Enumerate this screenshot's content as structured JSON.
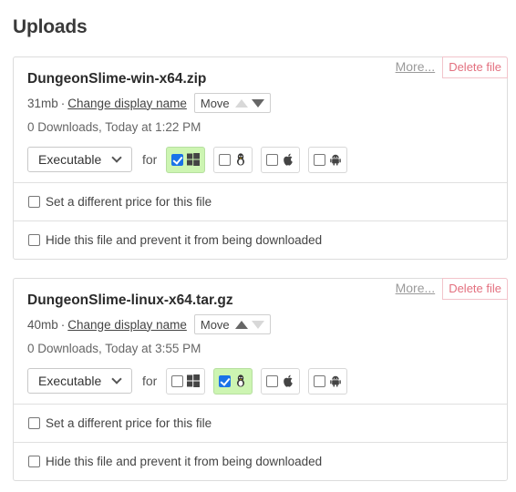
{
  "page": {
    "title": "Uploads"
  },
  "common": {
    "more_label": "More...",
    "delete_label": "Delete file",
    "change_name_label": "Change display name",
    "move_label": "Move",
    "separator": "·",
    "for_label": "for",
    "price_option": "Set a different price for this file",
    "hide_option": "Hide this file and prevent it from being downloaded"
  },
  "uploads": [
    {
      "file_name": "DungeonSlime-win-x64.zip",
      "size": "31mb",
      "stats": "0 Downloads, Today at 1:22 PM",
      "type": "Executable",
      "move_up_enabled": false,
      "move_down_enabled": true,
      "platforms": {
        "windows": true,
        "linux": false,
        "mac": false,
        "android": false
      },
      "price_checked": false,
      "hide_checked": false
    },
    {
      "file_name": "DungeonSlime-linux-x64.tar.gz",
      "size": "40mb",
      "stats": "0 Downloads, Today at 3:55 PM",
      "type": "Executable",
      "move_up_enabled": true,
      "move_down_enabled": false,
      "platforms": {
        "windows": false,
        "linux": true,
        "mac": false,
        "android": false
      },
      "price_checked": false,
      "hide_checked": false
    }
  ],
  "icons": {
    "windows": "windows-icon",
    "linux": "linux-tux-icon",
    "mac": "apple-icon",
    "android": "android-icon",
    "dropdown": "chevron-down-icon"
  },
  "colors": {
    "checked_platform_bg": "#cdf5b2",
    "checkbox_checked": "#1a73e8",
    "delete_text": "#e3707f"
  }
}
